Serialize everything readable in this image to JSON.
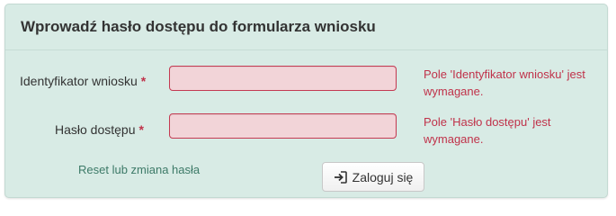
{
  "form": {
    "title": "Wprowadź hasło dostępu do formularza wniosku",
    "fields": [
      {
        "label": "Identyfikator wniosku",
        "required_mark": "*",
        "value": "",
        "error": "Pole 'Identyfikator wniosku' jest wymagane."
      },
      {
        "label": "Hasło dostępu",
        "required_mark": "*",
        "value": "",
        "error": "Pole 'Hasło dostępu' jest wymagane."
      }
    ],
    "reset_link": "Reset lub zmiana hasła",
    "login_button": {
      "label": "Zaloguj się",
      "icon": "sign-in-icon"
    }
  },
  "colors": {
    "panel_bg": "#d8ebe5",
    "error_text": "#c0324a",
    "input_error_bg": "#f2d4d8",
    "link": "#3d7a68"
  }
}
